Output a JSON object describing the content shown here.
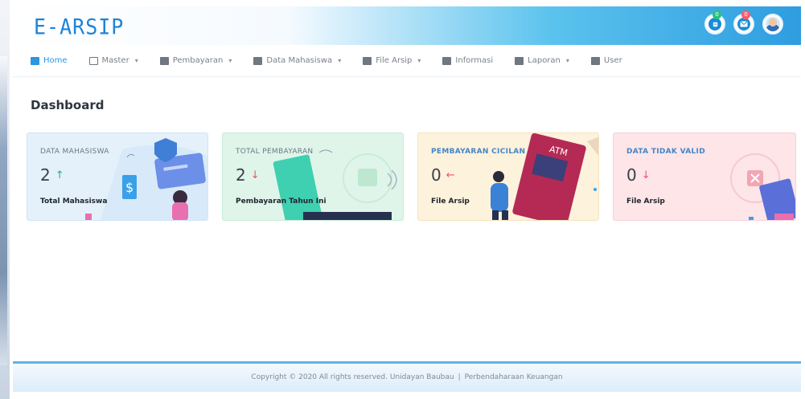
{
  "app": {
    "logo": "E-ARSIP"
  },
  "header": {
    "notifications_badge": "0",
    "messages_badge": "0"
  },
  "nav": {
    "items": [
      {
        "label": "Home",
        "icon": "home-icon",
        "dropdown": false,
        "active": true
      },
      {
        "label": "Master",
        "icon": "master-icon",
        "dropdown": true
      },
      {
        "label": "Pembayaran",
        "icon": "payment-icon",
        "dropdown": true
      },
      {
        "label": "Data Mahasiswa",
        "icon": "student-data-icon",
        "dropdown": true
      },
      {
        "label": "File Arsip",
        "icon": "archive-icon",
        "dropdown": true
      },
      {
        "label": "Informasi",
        "icon": "info-icon",
        "dropdown": false
      },
      {
        "label": "Laporan",
        "icon": "report-icon",
        "dropdown": true
      },
      {
        "label": "User",
        "icon": "user-icon",
        "dropdown": false
      }
    ]
  },
  "page": {
    "title": "Dashboard"
  },
  "cards": [
    {
      "label": "DATA MAHASISWA",
      "value": "2",
      "trend": "↑",
      "trend_color": "#27b07a",
      "caption": "Total Mahasiswa",
      "bg": "#e4f1fb"
    },
    {
      "label": "TOTAL PEMBAYARAN",
      "value": "2",
      "trend": "↓",
      "trend_color": "#f0506e",
      "caption": "Pembayaran Tahun Ini",
      "bg": "#dff5ea"
    },
    {
      "label": "PEMBAYARAN CICILAN",
      "value": "0",
      "trend": "←",
      "trend_color": "#f0506e",
      "caption": "File Arsip",
      "bg": "#fdf2dc"
    },
    {
      "label": "DATA TIDAK VALID",
      "value": "0",
      "trend": "↓",
      "trend_color": "#f0506e",
      "caption": "File Arsip",
      "bg": "#fde5e8"
    }
  ],
  "footer": {
    "copyright": "Copyright © 2020 All rights reserved. Unidayan Baubau",
    "separator": "|",
    "department": "Perbendaharaan Keuangan"
  },
  "colors": {
    "primary": "#1e83d8",
    "header_gradient_end": "#2e9de0",
    "footer_border": "#5cb4ea"
  }
}
